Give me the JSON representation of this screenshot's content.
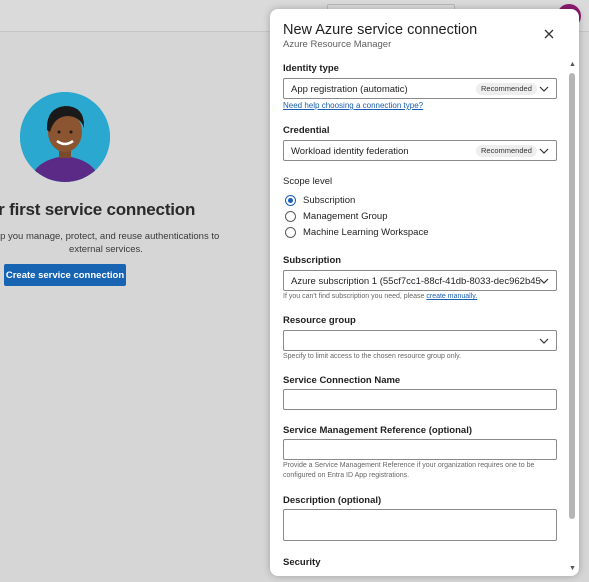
{
  "background": {
    "hero_title": "ur first service connection",
    "hero_description": "elp you manage, protect, and reuse authentications to external services.",
    "create_button_label": "Create service connection"
  },
  "panel": {
    "title": "New Azure service connection",
    "subtitle": "Azure Resource Manager",
    "identity_type": {
      "label": "Identity type",
      "value": "App registration (automatic)",
      "badge": "Recommended",
      "help_link": "Need help choosing a connection type?"
    },
    "credential": {
      "label": "Credential",
      "value": "Workload identity federation",
      "badge": "Recommended"
    },
    "scope_level": {
      "label": "Scope level",
      "options": [
        {
          "label": "Subscription",
          "selected": true
        },
        {
          "label": "Management Group",
          "selected": false
        },
        {
          "label": "Machine Learning Workspace",
          "selected": false
        }
      ]
    },
    "subscription": {
      "label": "Subscription",
      "value": "Azure subscription 1 (55cf7cc1-88cf-41db-8033-dec962b45...",
      "hint_text": "If you can't find subscription you need, please ",
      "hint_link": "create manually."
    },
    "resource_group": {
      "label": "Resource group",
      "value": "",
      "hint": "Specify to limit access to the chosen resource group only."
    },
    "service_connection_name": {
      "label": "Service Connection Name",
      "value": ""
    },
    "service_management_reference": {
      "label": "Service Management Reference (optional)",
      "value": "",
      "hint": "Provide a Service Management Reference if your organization requires one to be configured on Entra ID App registrations."
    },
    "description": {
      "label": "Description (optional)",
      "value": ""
    },
    "security": {
      "label": "Security"
    }
  },
  "colors": {
    "accent": "#1a5fb4",
    "primary_button": "#1764b3",
    "overlay": "#d6d6d6",
    "avatar_bg": "#2aa8cf"
  }
}
